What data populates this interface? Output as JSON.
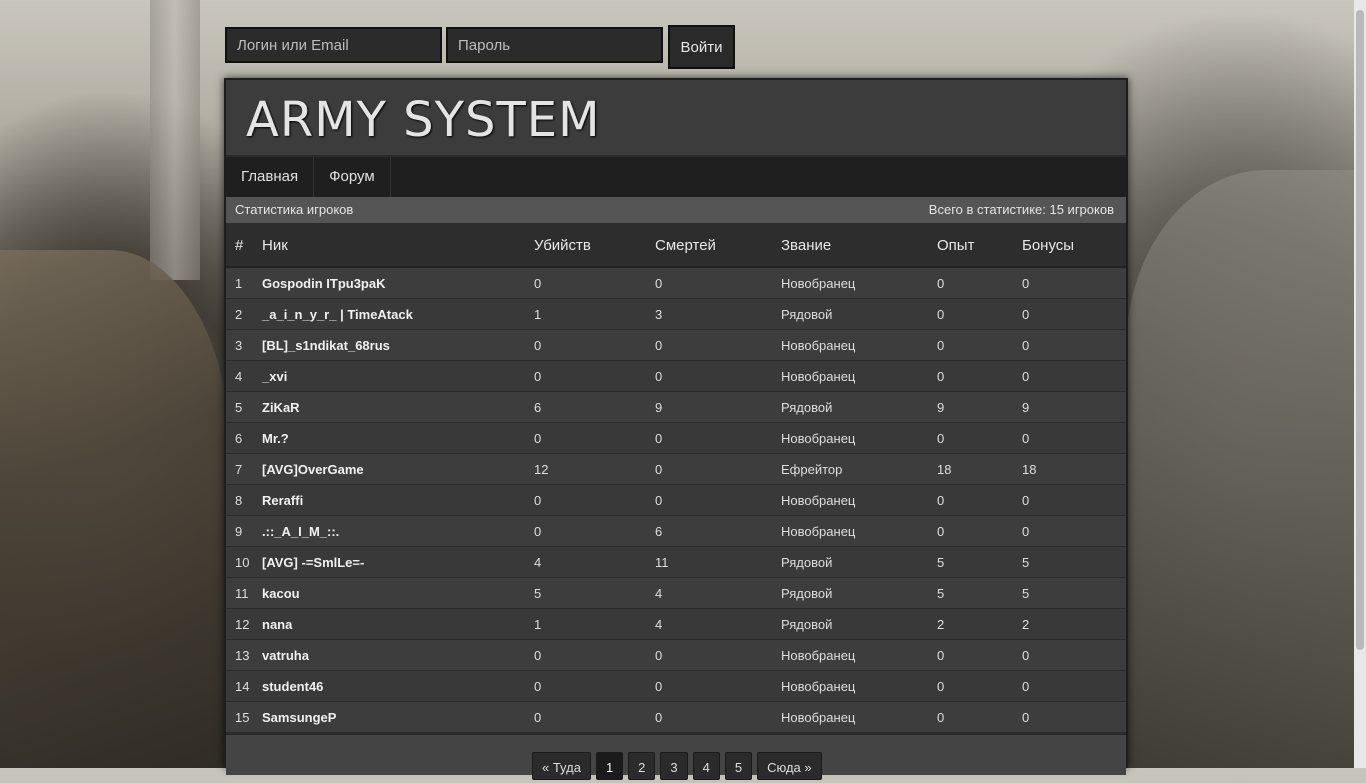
{
  "login": {
    "username_placeholder": "Логин или Email",
    "password_placeholder": "Пароль",
    "submit_label": "Войти"
  },
  "site": {
    "title": "ARMY SYSTEM"
  },
  "nav": [
    {
      "label": "Главная"
    },
    {
      "label": "Форум"
    }
  ],
  "stats": {
    "heading": "Статистика игроков",
    "total": "Всего в статистике: 15 игроков",
    "columns": [
      "#",
      "Ник",
      "Убийств",
      "Смертей",
      "Звание",
      "Опыт",
      "Бонусы"
    ],
    "rows": [
      [
        "1",
        "Gospodin ITpu3paK",
        "0",
        "0",
        "Новобранец",
        "0",
        "0"
      ],
      [
        "2",
        "_a_i_n_y_r_ | TimeAtack",
        "1",
        "3",
        "Рядовой",
        "0",
        "0"
      ],
      [
        "3",
        "[BL]_s1ndikat_68rus",
        "0",
        "0",
        "Новобранец",
        "0",
        "0"
      ],
      [
        "4",
        "_xvi",
        "0",
        "0",
        "Новобранец",
        "0",
        "0"
      ],
      [
        "5",
        "ZiKaR",
        "6",
        "9",
        "Рядовой",
        "9",
        "9"
      ],
      [
        "6",
        "Mr.?",
        "0",
        "0",
        "Новобранец",
        "0",
        "0"
      ],
      [
        "7",
        "[AVG]OverGame",
        "12",
        "0",
        "Ефрейтор",
        "18",
        "18"
      ],
      [
        "8",
        "Reraffi",
        "0",
        "0",
        "Новобранец",
        "0",
        "0"
      ],
      [
        "9",
        ".::_A_I_M_::.",
        "0",
        "6",
        "Новобранец",
        "0",
        "0"
      ],
      [
        "10",
        "[AVG] -=SmlLe=-",
        "4",
        "11",
        "Рядовой",
        "5",
        "5"
      ],
      [
        "11",
        "kacou",
        "5",
        "4",
        "Рядовой",
        "5",
        "5"
      ],
      [
        "12",
        "nana",
        "1",
        "4",
        "Рядовой",
        "2",
        "2"
      ],
      [
        "13",
        "vatruha",
        "0",
        "0",
        "Новобранец",
        "0",
        "0"
      ],
      [
        "14",
        "student46",
        "0",
        "0",
        "Новобранец",
        "0",
        "0"
      ],
      [
        "15",
        "SamsungeP",
        "0",
        "0",
        "Новобранец",
        "0",
        "0"
      ]
    ]
  },
  "pagination": {
    "items": [
      "« Туда",
      "1",
      "2",
      "3",
      "4",
      "5",
      "Сюда »"
    ],
    "active": "1"
  }
}
